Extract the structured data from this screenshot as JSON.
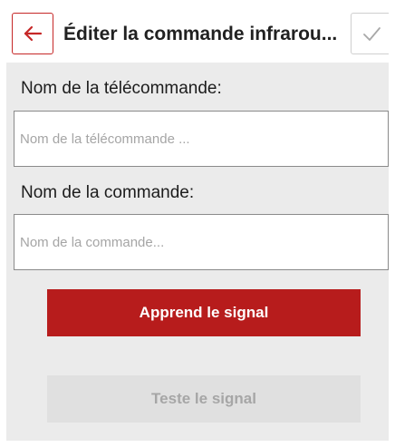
{
  "header": {
    "title": "Éditer la commande infrarou...",
    "back_icon": "arrow-left-icon",
    "confirm_icon": "check-icon",
    "accent_color": "#b71c1c"
  },
  "form": {
    "remote_name_label": "Nom de la télécommande:",
    "remote_name_placeholder": "Nom de la télécommande ...",
    "remote_name_value": "",
    "command_name_label": "Nom de la commande:",
    "command_name_placeholder": "Nom de la commande...",
    "command_name_value": ""
  },
  "actions": {
    "learn_label": "Apprend le signal",
    "test_label": "Teste le signal",
    "test_enabled": false
  }
}
